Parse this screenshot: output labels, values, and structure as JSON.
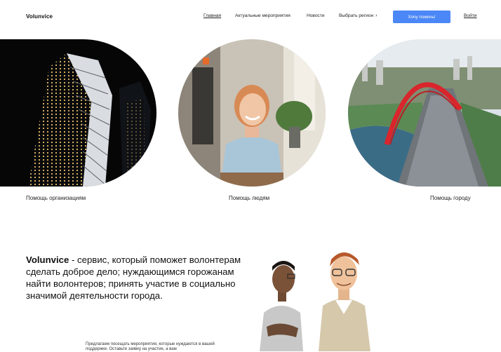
{
  "header": {
    "logo": "Volunvice",
    "nav": [
      {
        "label": "Главная",
        "active": true
      },
      {
        "label": "Актуальные мероприятия",
        "active": false
      },
      {
        "label": "Новости",
        "active": false
      },
      {
        "label": "Выбрать регион",
        "active": false
      }
    ],
    "region_chevron": "›",
    "cta_label": "Хочу помочь!",
    "login_label": "Войти",
    "accent_color": "#4b87f6"
  },
  "categories": [
    {
      "label": "Помощь организациям",
      "image": "skyscraper-photo"
    },
    {
      "label": "Помощь людям",
      "image": "smiling-woman-photo"
    },
    {
      "label": "Помощь городу",
      "image": "red-arch-bridge-photo"
    }
  ],
  "about": {
    "brand": "Volunvice",
    "text": " - сервис, который поможет волонтерам сделать доброе дело; нуждающимся горожанам найти волонтеров; принять участие в социально значимой деятельности города.",
    "small_text": "Предлагаем посещать мероприятия, которые нуждаются в вашей поддержке. Оставьте заявку на участие, а вам"
  }
}
